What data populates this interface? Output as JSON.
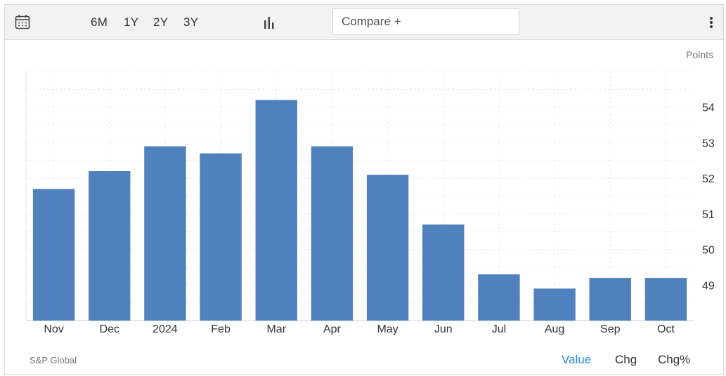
{
  "toolbar": {
    "ranges": [
      "6M",
      "1Y",
      "2Y",
      "3Y"
    ],
    "compare_placeholder": "Compare +"
  },
  "icons": {
    "calendar": "calendar-icon",
    "chart_type": "bar-chart-icon",
    "more": "more-vertical-icon"
  },
  "chart_data": {
    "type": "bar",
    "categories": [
      "Nov",
      "Dec",
      "2024",
      "Feb",
      "Mar",
      "Apr",
      "May",
      "Jun",
      "Jul",
      "Aug",
      "Sep",
      "Oct"
    ],
    "values": [
      51.7,
      52.2,
      52.9,
      52.7,
      54.2,
      52.9,
      52.1,
      50.7,
      49.3,
      48.9,
      49.2,
      49.2
    ],
    "ylabel": "Points",
    "yticks": [
      49,
      50,
      51,
      52,
      53,
      54
    ],
    "ylim": [
      48,
      55
    ],
    "grid": true,
    "color": "#4f81bd"
  },
  "footer": {
    "source": "S&P Global",
    "modes": [
      "Value",
      "Chg",
      "Chg%"
    ],
    "active_mode": "Value",
    "active_color": "#2a8ad8"
  }
}
